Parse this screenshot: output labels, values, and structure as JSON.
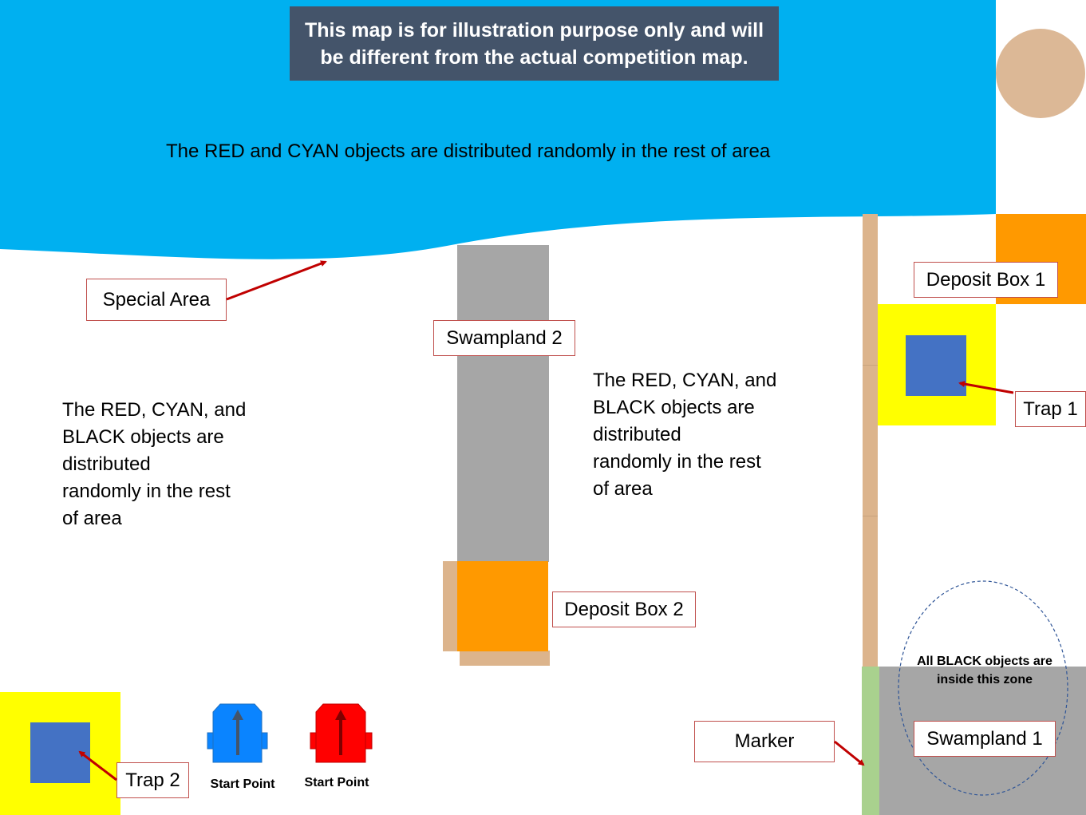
{
  "disclaimer": {
    "line1": "This  map is for illustration purpose only and will",
    "line2": "be different from the actual competition map."
  },
  "special_area_text": "The RED and CYAN objects are distributed randomly in the rest of area",
  "left_text": [
    "The RED, CYAN, and",
    "BLACK objects are",
    "distributed",
    "randomly in the rest",
    "of area"
  ],
  "middle_text": [
    "The RED, CYAN, and",
    "BLACK objects are",
    "distributed",
    "randomly in the rest",
    "of area"
  ],
  "labels": {
    "special_area": "Special Area",
    "swampland_2": "Swampland 2",
    "deposit_box_1": "Deposit Box 1",
    "trap_1": "Trap 1",
    "deposit_box_2": "Deposit Box 2",
    "trap_2": "Trap 2",
    "marker": "Marker",
    "swampland_1": "Swampland 1",
    "black_zone_line1": "All BLACK objects are",
    "black_zone_line2": "inside this zone",
    "start_point_blue": "Start Point",
    "start_point_red": "Start Point"
  },
  "colors": {
    "special_area": "#00b0f0",
    "disclaimer_bg": "#44546a",
    "swampland": "#a6a6a6",
    "deposit_box": "#ff9900",
    "trap_zone": "#ffff00",
    "trap_core": "#4472c4",
    "wall": "#dcb48c",
    "marker": "#a9d18e",
    "label_border": "#c0504d",
    "arrow": "#c00000",
    "robot_blue": "#0a84ff",
    "robot_red": "#ff0000"
  },
  "icons": [
    "sun-circle-icon",
    "blue-robot-icon",
    "red-robot-icon"
  ]
}
